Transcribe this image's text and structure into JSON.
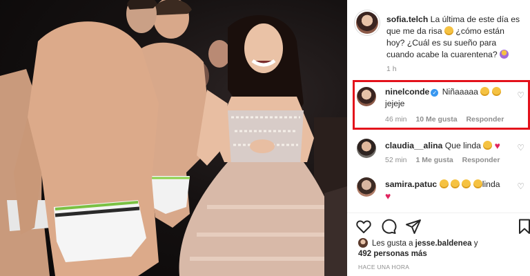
{
  "post": {
    "author": "sofia.telch",
    "caption_line1": "La última de este día es que me da risa",
    "caption_line2": "¿cómo están hoy? ¿Cuál es su sueño para cuando acabe la cuarentena?",
    "caption_time": "1 h"
  },
  "comments": [
    {
      "username": "ninelconde",
      "verified": true,
      "text_line1": "Niñaaaaa",
      "text_line2": "jejeje",
      "time": "46 min",
      "likes": "10 Me gusta",
      "reply": "Responder",
      "highlighted": true
    },
    {
      "username": "claudia__alina",
      "text_line1": "Que linda",
      "time": "52 min",
      "likes": "1 Me gusta",
      "reply": "Responder"
    },
    {
      "username": "samira.patuc",
      "text_line1": "linda",
      "time": "",
      "likes": "",
      "reply": ""
    }
  ],
  "actions": {
    "like_icon": "heart-icon",
    "comment_icon": "comment-icon",
    "share_icon": "share-icon",
    "save_icon": "bookmark-icon"
  },
  "likes_summary": {
    "prefix": "Les gusta a",
    "user": "jesse.baldenea",
    "joiner": "y",
    "others": "492 personas más"
  },
  "posted_ago": "HACE UNA HORA",
  "colors": {
    "highlight_border": "#e3111b",
    "verified": "#3897f0",
    "muted_text": "#8e8e8e"
  }
}
